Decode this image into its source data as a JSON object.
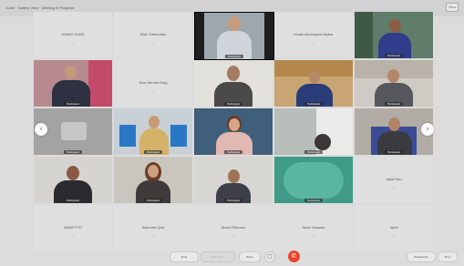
{
  "window": {
    "title": "Zoom · Gallery View · Meeting in Progress",
    "top_right_label": "View"
  },
  "tiles": [
    {
      "type": "blank",
      "name": "HAMID KHAN",
      "num": "• •"
    },
    {
      "type": "blank",
      "name": "Mian Zahiruddin",
      "num": "• •"
    },
    {
      "type": "video",
      "label": "Participant"
    },
    {
      "type": "blank",
      "name": "Khalid Aurangzeb Babar",
      "num": "• •"
    },
    {
      "type": "video",
      "label": "Participant"
    },
    {
      "type": "video",
      "label": "Participant"
    },
    {
      "type": "blank",
      "name": "Riaz Ahmad Nagi",
      "num": "• •"
    },
    {
      "type": "video",
      "label": "Participant"
    },
    {
      "type": "video",
      "label": "Participant"
    },
    {
      "type": "video",
      "label": "Participant"
    },
    {
      "type": "video",
      "label": "Participant"
    },
    {
      "type": "video",
      "label": "Participant"
    },
    {
      "type": "video",
      "label": "Participant"
    },
    {
      "type": "video",
      "label": "Participant"
    },
    {
      "type": "video",
      "label": "Participant"
    },
    {
      "type": "video",
      "label": "Participant"
    },
    {
      "type": "video",
      "label": "Participant"
    },
    {
      "type": "video",
      "label": "Participant"
    },
    {
      "type": "video",
      "label": "Participant"
    },
    {
      "type": "blank",
      "name": "Iqbal Rao",
      "num": "• •"
    },
    {
      "type": "blank",
      "name": "SAMP PTC",
      "num": "• •"
    },
    {
      "type": "blank",
      "name": "Suleman Qazi",
      "num": "• •"
    },
    {
      "type": "blank",
      "name": "Abdul Rehman",
      "num": "• •"
    },
    {
      "type": "blank",
      "name": "Nasir Hussain",
      "num": "• •"
    },
    {
      "type": "blank",
      "name": "Iqbal",
      "num": "• •"
    }
  ],
  "toolbar": {
    "mute_label": "Mute",
    "video_label": "Start Video",
    "share_label": "Share",
    "chat_label": "Chat",
    "participants_label": "Participants",
    "more_label": "More"
  }
}
